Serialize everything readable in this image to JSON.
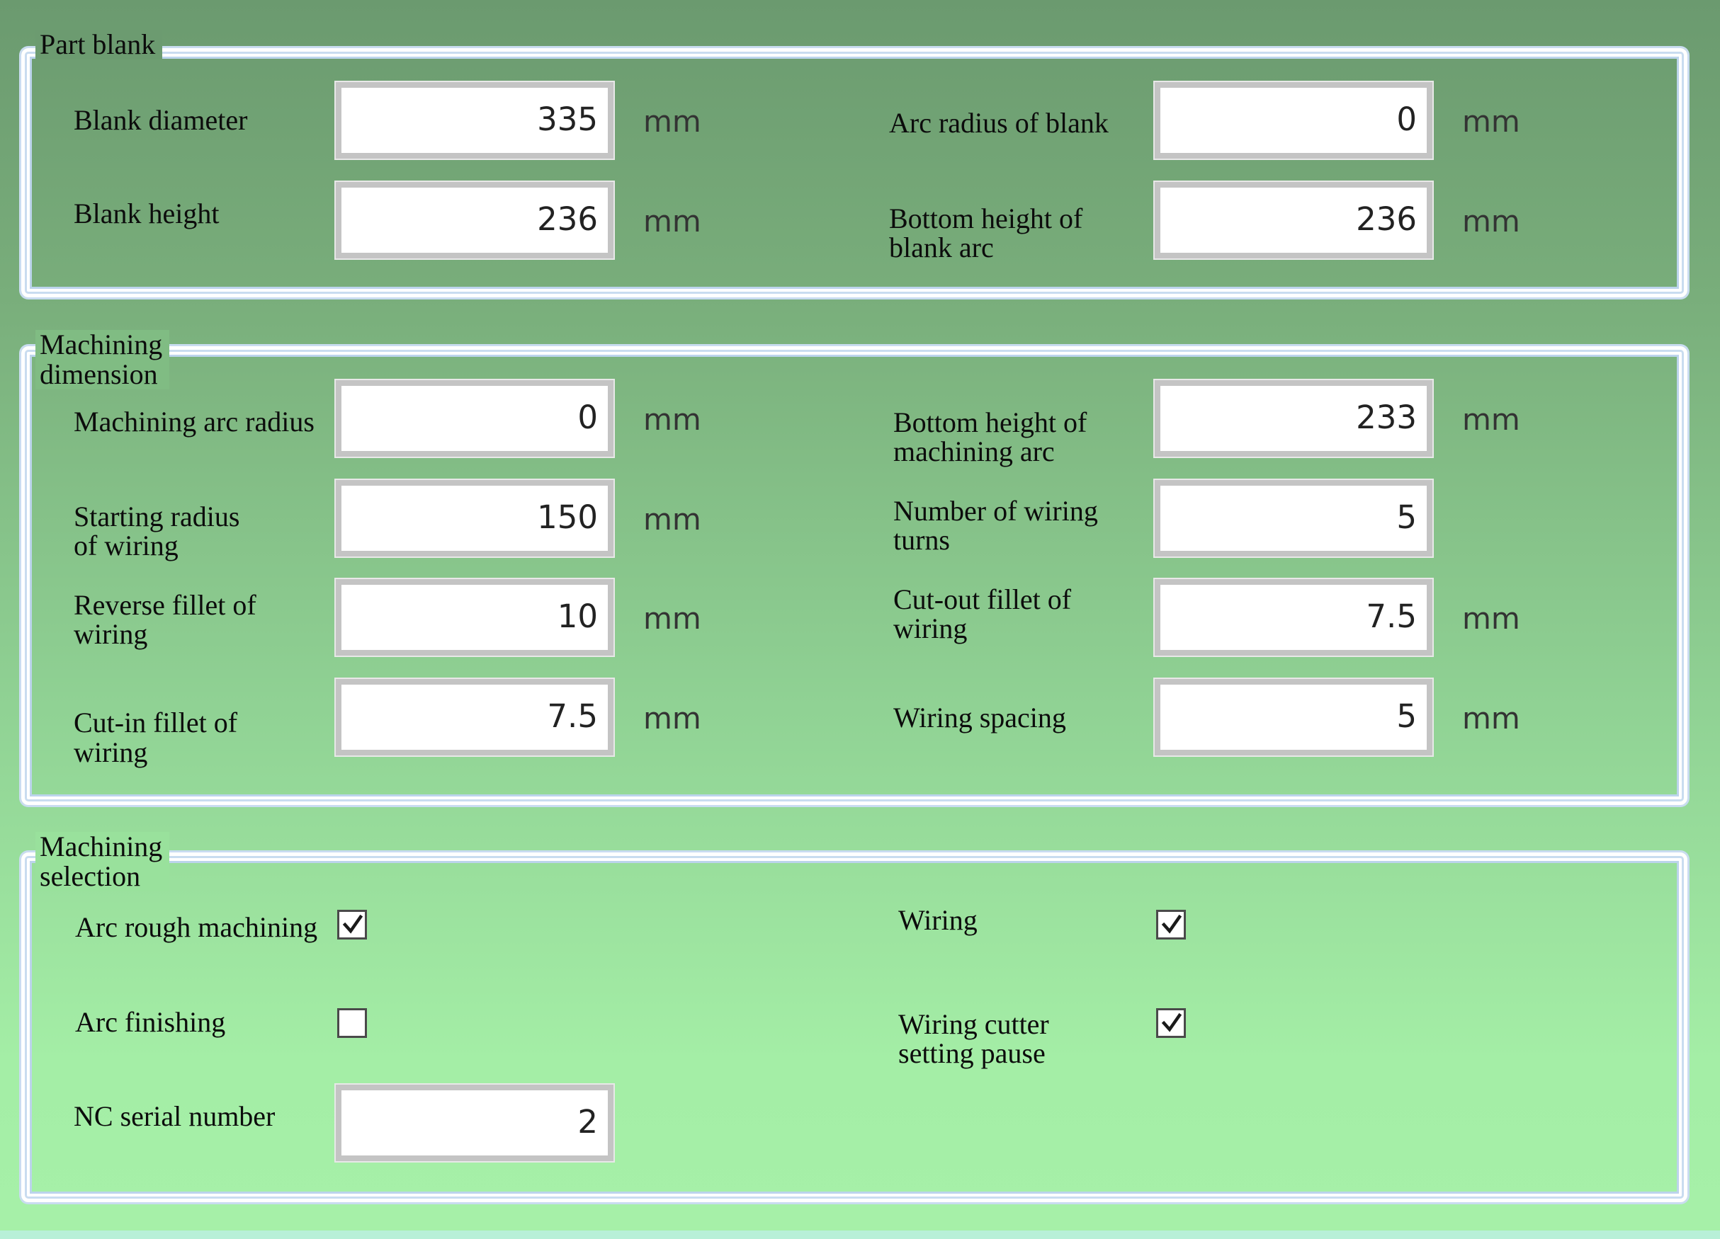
{
  "part_blank": {
    "title": "Part blank",
    "blank_diameter": {
      "label": "Blank diameter",
      "value": "335",
      "unit": "mm"
    },
    "arc_radius_of_blank": {
      "label": "Arc radius of blank",
      "value": "0",
      "unit": "mm"
    },
    "blank_height": {
      "label": "Blank height",
      "value": "236",
      "unit": "mm"
    },
    "bottom_height_of_blank_arc": {
      "label_line1": "Bottom height of",
      "label_line2": "blank arc",
      "value": "236",
      "unit": "mm"
    }
  },
  "machining_dimension": {
    "title_line1": "Machining",
    "title_line2": "dimension",
    "machining_arc_radius": {
      "label": "Machining arc radius",
      "value": "0",
      "unit": "mm"
    },
    "bottom_height_of_machining_arc": {
      "label_line1": "Bottom height of",
      "label_line2": "machining arc",
      "value": "233",
      "unit": "mm"
    },
    "starting_radius_of_wiring": {
      "label_line1": "Starting radius",
      "label_line2": "of wiring",
      "value": "150",
      "unit": "mm"
    },
    "number_of_wiring_turns": {
      "label_line1": "Number of wiring",
      "label_line2": "turns",
      "value": "5"
    },
    "reverse_fillet_of_wiring": {
      "label_line1": "Reverse fillet of",
      "label_line2": "wiring",
      "value": "10",
      "unit": "mm"
    },
    "cut_out_fillet_of_wiring": {
      "label_line1": "Cut-out fillet of",
      "label_line2": "wiring",
      "value": "7.5",
      "unit": "mm"
    },
    "cut_in_fillet_of_wiring": {
      "label_line1": "Cut-in fillet of",
      "label_line2": "wiring",
      "value": "7.5",
      "unit": "mm"
    },
    "wiring_spacing": {
      "label": "Wiring spacing",
      "value": "5",
      "unit": "mm"
    }
  },
  "machining_selection": {
    "title_line1": "Machining",
    "title_line2": "selection",
    "arc_rough_machining": {
      "label": "Arc rough machining",
      "checked": true
    },
    "wiring": {
      "label": "Wiring",
      "checked": true
    },
    "arc_finishing": {
      "label": "Arc finishing",
      "checked": false
    },
    "wiring_cutter_setting_pause": {
      "label_line1": "Wiring cutter",
      "label_line2": "setting pause",
      "checked": true
    },
    "nc_serial_number": {
      "label": "NC serial number",
      "value": "2"
    }
  },
  "colors": {
    "field_border": "#c4c4c4",
    "group_border": "#ffffff",
    "checkbox_border": "#4a4a4a"
  },
  "icons": {
    "checkbox_checked": "checkmark-icon"
  }
}
